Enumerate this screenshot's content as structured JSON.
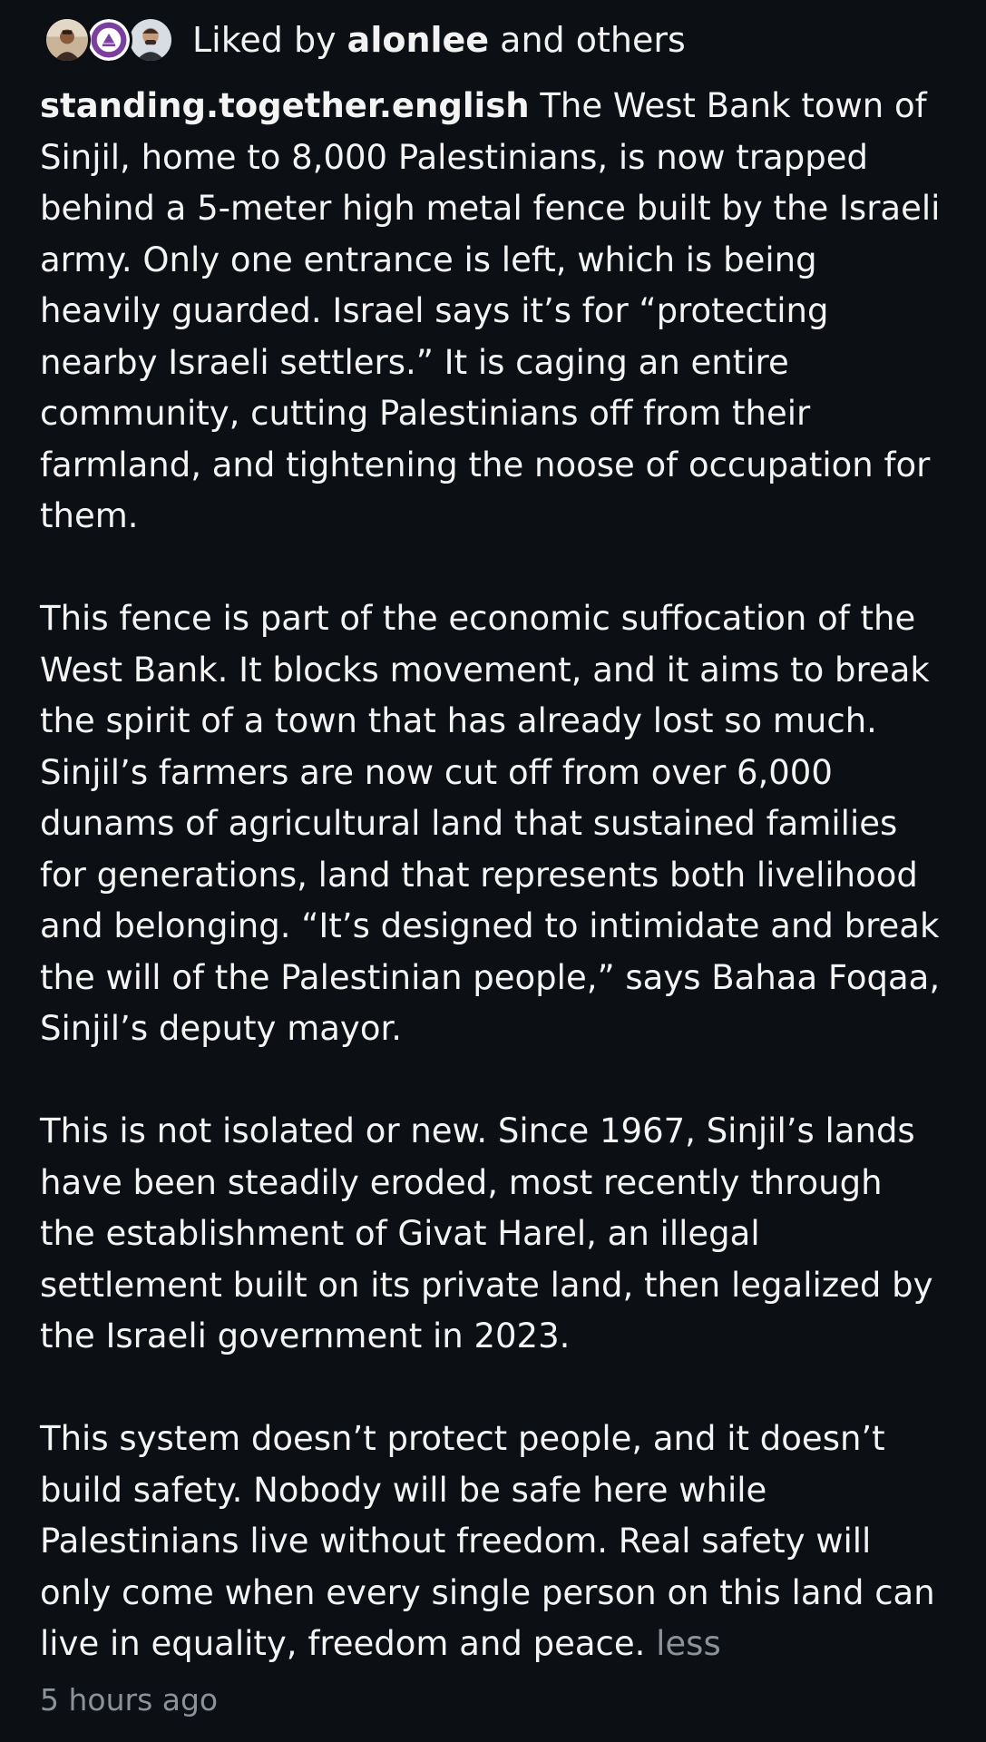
{
  "likes": {
    "prefix": "Liked by",
    "user": "alonlee",
    "suffix": "and others",
    "avatars": [
      "avatar-alonlee",
      "avatar-standing-together-logo",
      "avatar-user"
    ]
  },
  "post": {
    "username": "standing.together.english",
    "paragraphs": [
      "The West Bank town of Sinjil, home to 8,000 Palestinians, is now trapped behind a 5-meter high metal fence built by the Israeli army. Only one entrance is left, which is being heavily guarded. Israel says it’s for “protecting nearby Israeli settlers.” It is caging an entire community, cutting Palestinians off from their farmland, and tightening the noose of occupation for them.",
      "This fence is part of the economic suffocation of the West Bank. It blocks movement, and it aims to break the spirit of a town that has already lost so much. Sinjil’s farmers are now cut off from over 6,000 dunams of agricultural land that sustained families for generations, land that represents both livelihood and belonging. “It’s designed to intimidate and break the will of the Palestinian people,” says Bahaa Foqaa, Sinjil’s deputy mayor.",
      "This is not isolated or new. Since 1967, Sinjil’s lands have been steadily eroded, most recently through the establishment of Givat Harel, an illegal settlement built on its private land, then legalized by the Israeli government in 2023.",
      "This system doesn’t protect people, and it doesn’t build safety. Nobody will be safe here while Palestinians live without freedom. Real safety will only come when every single person on this land can live in equality, freedom and peace."
    ],
    "less_label": "less",
    "timestamp": "5 hours ago"
  },
  "colors": {
    "background": "#0c0f14",
    "text": "#f4f4f4",
    "muted": "#8d929a",
    "logo_purple": "#7b3fa0"
  }
}
